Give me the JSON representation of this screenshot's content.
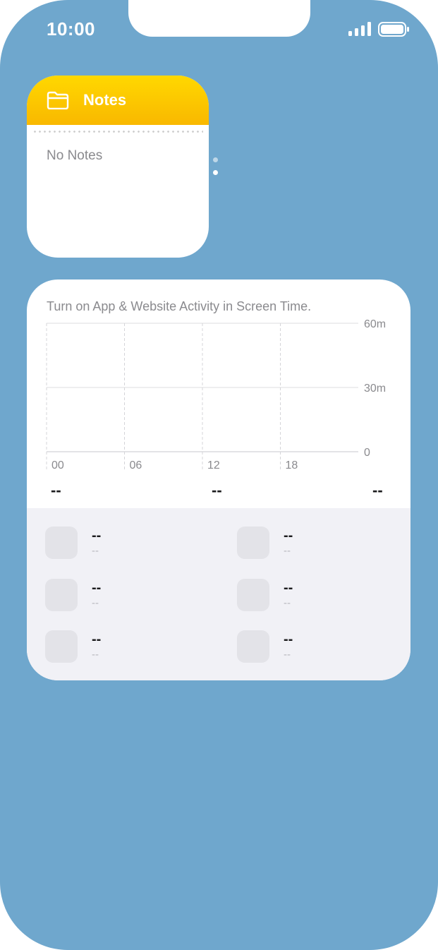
{
  "status_bar": {
    "time": "10:00"
  },
  "notes_widget": {
    "title": "Notes",
    "empty_text": "No Notes"
  },
  "screen_time": {
    "message": "Turn on App & Website Activity in Screen Time.",
    "chart_data": {
      "type": "bar",
      "categories": [
        "00",
        "06",
        "12",
        "18"
      ],
      "y_ticks": [
        "60m",
        "30m",
        "0"
      ],
      "values": []
    },
    "summary": [
      "--",
      "--",
      "--"
    ],
    "apps": [
      {
        "name": "--",
        "time": "--"
      },
      {
        "name": "--",
        "time": "--"
      },
      {
        "name": "--",
        "time": "--"
      },
      {
        "name": "--",
        "time": "--"
      },
      {
        "name": "--",
        "time": "--"
      },
      {
        "name": "--",
        "time": "--"
      }
    ]
  }
}
